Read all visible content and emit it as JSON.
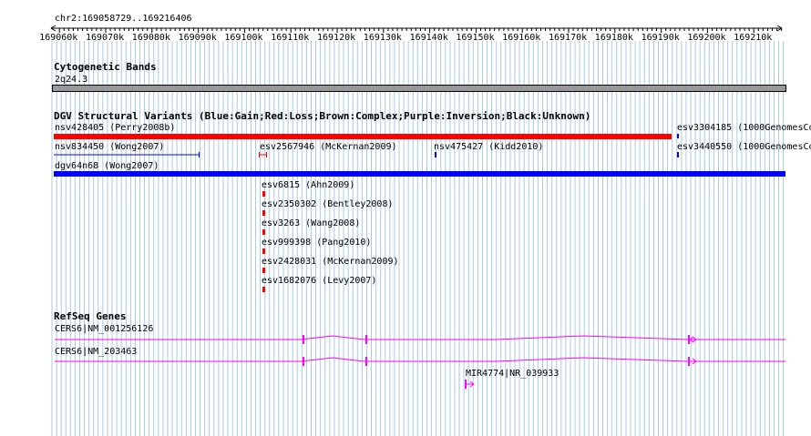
{
  "ruler": {
    "range": "chr2:169058729..169216406",
    "ticks": [
      "169060k",
      "169070k",
      "169080k",
      "169090k",
      "169100k",
      "169110k",
      "169120k",
      "169130k",
      "169140k",
      "169150k",
      "169160k",
      "169170k",
      "169180k",
      "169190k",
      "169200k",
      "169210k"
    ]
  },
  "cytoband": {
    "title": "Cytogenetic Bands",
    "band": "2q24.3"
  },
  "dgv": {
    "title": "DGV Structural Variants (Blue:Gain;Red:Loss;Brown:Complex;Purple:Inversion;Black:Unknown)",
    "features": [
      {
        "label": "nsv428405 (Perry2008b)",
        "type": "Loss",
        "color": "#ff0000"
      },
      {
        "label": "esv3304185 (1000GenomesCo",
        "type": "Gain",
        "color": "#0000ff"
      },
      {
        "label": "nsv834450 (Wong2007)",
        "type": "Gain",
        "color": "#0000ff"
      },
      {
        "label": "esv2567946 (McKernan2009)",
        "type": "Loss",
        "color": "#ff0000"
      },
      {
        "label": "nsv475427 (Kidd2010)",
        "type": "Gain",
        "color": "#0000ff"
      },
      {
        "label": "esv3440550 (1000GenomesCo",
        "type": "Gain",
        "color": "#0000ff"
      },
      {
        "label": "dgv64n68 (Wong2007)",
        "type": "Gain",
        "color": "#0000ff"
      },
      {
        "label": "esv6815 (Ahn2009)",
        "type": "Loss",
        "color": "#ff0000"
      },
      {
        "label": "esv2350302 (Bentley2008)",
        "type": "Loss",
        "color": "#ff0000"
      },
      {
        "label": "esv3263 (Wang2008)",
        "type": "Loss",
        "color": "#ff0000"
      },
      {
        "label": "esv999398 (Pang2010)",
        "type": "Loss",
        "color": "#ff0000"
      },
      {
        "label": "esv2428031 (McKernan2009)",
        "type": "Loss",
        "color": "#ff0000"
      },
      {
        "label": "esv1682076 (Levy2007)",
        "type": "Loss",
        "color": "#ff0000"
      }
    ]
  },
  "refseq": {
    "title": "RefSeq Genes",
    "genes": [
      {
        "label": "CERS6|NM_001256126"
      },
      {
        "label": "CERS6|NM_203463"
      },
      {
        "label": "MIR4774|NR_039933"
      }
    ],
    "color": "#ff00ff"
  },
  "colors": {
    "grid": "#a8cbe0",
    "gain": "#0000ff",
    "loss": "#ff0000",
    "gene": "#ff00ff",
    "band": "#999999"
  }
}
